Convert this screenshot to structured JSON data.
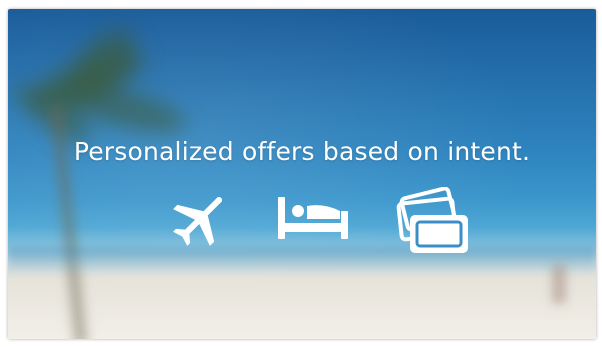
{
  "banner": {
    "headline": "Personalized offers based on intent."
  },
  "icons": [
    {
      "name": "airplane-icon"
    },
    {
      "name": "bed-icon"
    },
    {
      "name": "tickets-icon"
    }
  ],
  "colors": {
    "sky_top": "#1a5c9a",
    "sky_mid": "#2f86c0",
    "sand": "#f2efe8",
    "text": "#ffffff"
  }
}
